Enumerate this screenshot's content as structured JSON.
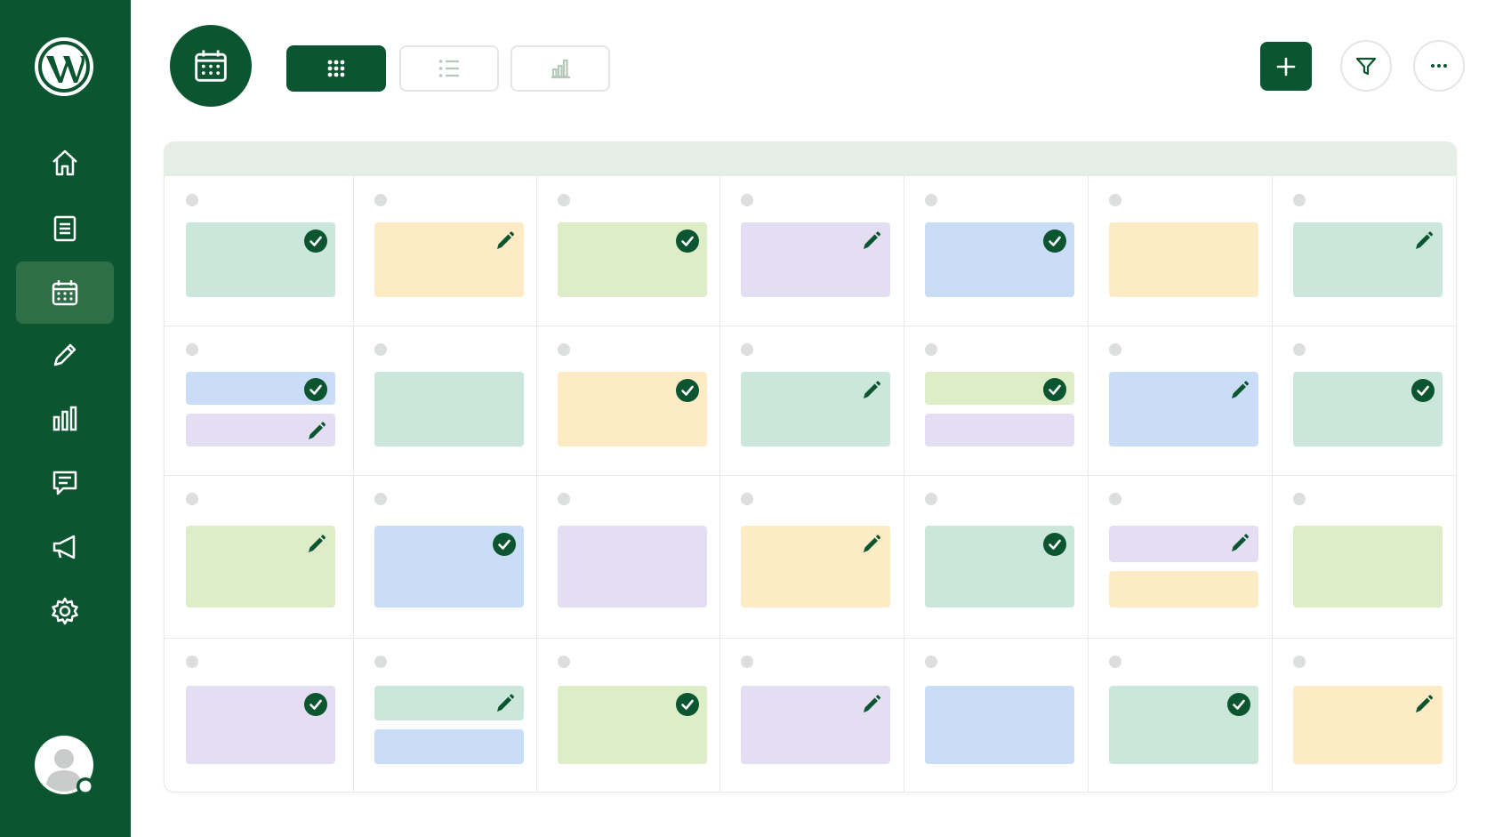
{
  "sidebar": {
    "logo": "wordpress-logo",
    "items": [
      {
        "icon": "home-icon",
        "name": "home",
        "active": false
      },
      {
        "icon": "document-icon",
        "name": "posts",
        "active": false
      },
      {
        "icon": "calendar-icon",
        "name": "calendar",
        "active": true
      },
      {
        "icon": "pencil-icon",
        "name": "drafts",
        "active": false
      },
      {
        "icon": "bar-chart-icon",
        "name": "analytics",
        "active": false
      },
      {
        "icon": "comment-icon",
        "name": "comments",
        "active": false
      },
      {
        "icon": "megaphone-icon",
        "name": "campaigns",
        "active": false
      },
      {
        "icon": "gear-icon",
        "name": "settings",
        "active": false
      }
    ],
    "avatar": "user-avatar"
  },
  "toolbar": {
    "calendar_badge": "calendar-icon",
    "views": [
      {
        "icon": "grid-view-icon",
        "name": "grid",
        "active": true
      },
      {
        "icon": "list-view-icon",
        "name": "list",
        "active": false
      },
      {
        "icon": "chart-view-icon",
        "name": "chart",
        "active": false
      }
    ],
    "actions": [
      "plus-icon",
      "filter-icon",
      "more-icon"
    ]
  },
  "colors": {
    "brand": "#0b5630",
    "mint": "#cbe6da",
    "peach": "#fdebc6",
    "lime": "#dcedc8",
    "lavender": "#e4def2",
    "blue": "#c9ddf6",
    "status_done": "check-circle-icon",
    "status_draft": "pencil-icon"
  },
  "calendar": {
    "columns": 7,
    "rows": [
      [
        [
          {
            "color": "mint",
            "status": "done"
          }
        ],
        [
          {
            "color": "peach",
            "status": "draft"
          }
        ],
        [
          {
            "color": "lime",
            "status": "done"
          }
        ],
        [
          {
            "color": "lavender",
            "status": "draft"
          }
        ],
        [
          {
            "color": "blue",
            "status": "done"
          }
        ],
        [
          {
            "color": "peach",
            "status": null
          }
        ],
        [
          {
            "color": "mint",
            "status": "draft"
          }
        ]
      ],
      [
        [
          {
            "color": "blue",
            "status": "done"
          },
          {
            "color": "lavender",
            "status": "draft"
          }
        ],
        [
          {
            "color": "mint",
            "status": null
          }
        ],
        [
          {
            "color": "peach",
            "status": "done"
          }
        ],
        [
          {
            "color": "mint",
            "status": "draft"
          }
        ],
        [
          {
            "color": "lime",
            "status": "done"
          },
          {
            "color": "lavender",
            "status": null
          }
        ],
        [
          {
            "color": "blue",
            "status": "draft"
          }
        ],
        [
          {
            "color": "mint",
            "status": "done"
          }
        ]
      ],
      [
        [
          {
            "color": "lime",
            "status": "draft"
          }
        ],
        [
          {
            "color": "blue",
            "status": "done"
          }
        ],
        [
          {
            "color": "lavender",
            "status": null
          }
        ],
        [
          {
            "color": "peach",
            "status": "draft"
          }
        ],
        [
          {
            "color": "mint",
            "status": "done"
          }
        ],
        [
          {
            "color": "lavender",
            "status": "draft"
          },
          {
            "color": "peach",
            "status": null
          }
        ],
        [
          {
            "color": "lime",
            "status": null
          }
        ]
      ],
      [
        [
          {
            "color": "lavender",
            "status": "done"
          }
        ],
        [
          {
            "color": "mint",
            "status": "draft"
          },
          {
            "color": "blue",
            "status": null
          }
        ],
        [
          {
            "color": "lime",
            "status": "done"
          }
        ],
        [
          {
            "color": "lavender",
            "status": "draft"
          }
        ],
        [
          {
            "color": "blue",
            "status": null
          }
        ],
        [
          {
            "color": "mint",
            "status": "done"
          }
        ],
        [
          {
            "color": "peach",
            "status": "draft"
          }
        ]
      ]
    ]
  }
}
